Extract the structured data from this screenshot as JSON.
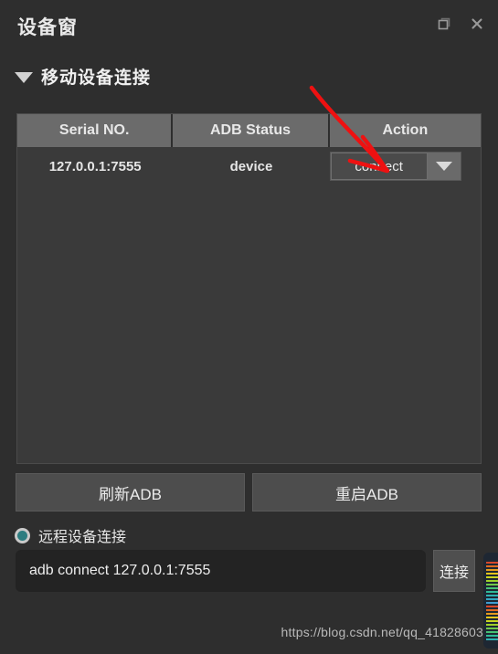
{
  "window": {
    "title": "设备窗",
    "restore_icon": "restore-window-icon",
    "close_icon": "close-icon"
  },
  "section": {
    "collapse_icon": "triangle-down-icon",
    "title": "移动设备连接"
  },
  "table": {
    "columns": [
      "Serial NO.",
      "ADB Status",
      "Action"
    ],
    "rows": [
      {
        "serial": "127.0.0.1:7555",
        "adb_status": "device",
        "action_label": "connect",
        "action_arrow_icon": "chevron-down-icon"
      }
    ]
  },
  "buttons": {
    "refresh_adb": "刷新ADB",
    "restart_adb": "重启ADB"
  },
  "remote": {
    "radio_label": "远程设备连接",
    "radio_selected": true,
    "input_value": "adb connect 127.0.0.1:7555",
    "input_placeholder": "adb connect",
    "connect_button": "连接"
  },
  "watermark": {
    "text": "https://blog.csdn.net/qq_41828603"
  },
  "colors": {
    "window_bg": "#2e2e2e",
    "header_bg": "#6b6b6b",
    "table_bg": "#3a3a3a",
    "accent_teal": "#2d7d80",
    "annotation_red": "#ee1111",
    "text": "#e6e6e6"
  }
}
